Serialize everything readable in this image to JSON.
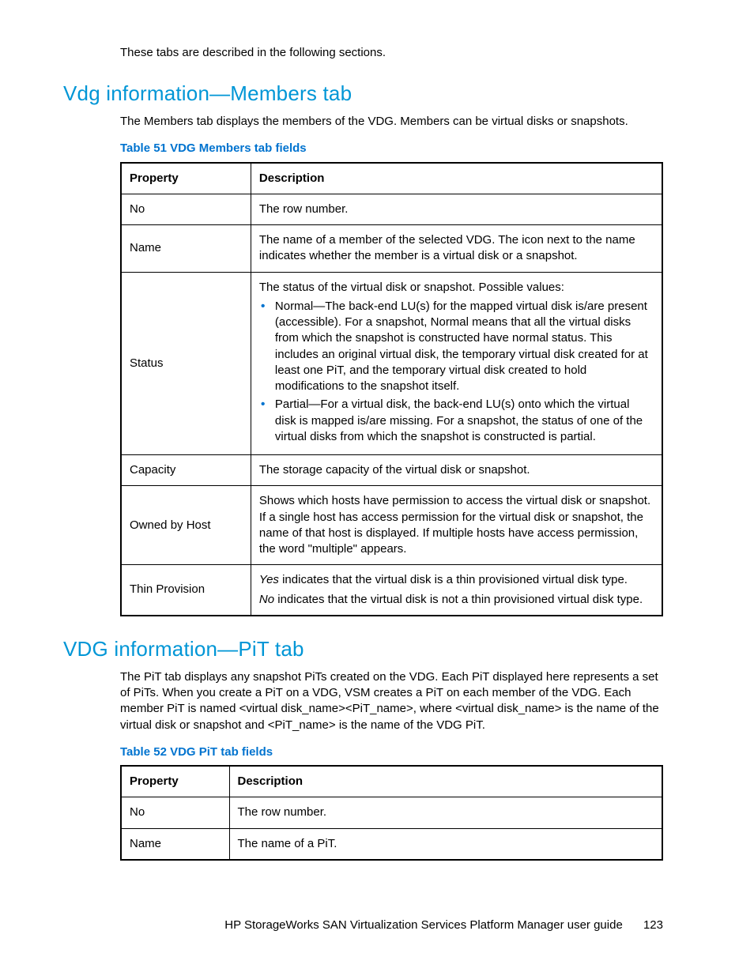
{
  "intro": "These tabs are described in the following sections.",
  "section1": {
    "heading": "Vdg information—Members tab",
    "body": "The Members tab displays the members of the VDG. Members can be virtual disks or snapshots.",
    "table_caption": "Table 51 VDG Members tab fields",
    "headers": {
      "prop": "Property",
      "desc": "Description"
    },
    "rows": {
      "r0": {
        "prop": "No",
        "desc": "The row number."
      },
      "r1": {
        "prop": "Name",
        "desc": "The name of a member of the selected VDG. The icon next to the name indicates whether the member is a virtual disk or a snapshot."
      },
      "r2": {
        "prop": "Status",
        "lead": "The status of the virtual disk or snapshot. Possible values:",
        "b0": "Normal—The back-end LU(s) for the mapped virtual disk is/are present (accessible). For a snapshot, Normal means that all the virtual disks from which the snapshot is constructed have normal status. This includes an original virtual disk, the temporary virtual disk created for at least one PiT, and the temporary virtual disk created to hold modifications to the snapshot itself.",
        "b1": "Partial—For a virtual disk, the back-end LU(s) onto which the virtual disk is mapped is/are missing. For a snapshot, the status of one of the virtual disks from which the snapshot is constructed is partial."
      },
      "r3": {
        "prop": "Capacity",
        "desc": "The storage capacity of the virtual disk or snapshot."
      },
      "r4": {
        "prop": "Owned by Host",
        "desc": "Shows which hosts have permission to access the virtual disk or snapshot. If a single host has access permission for the virtual disk or snapshot, the name of that host is displayed. If multiple hosts have access permission, the word \"multiple\" appears."
      },
      "r5": {
        "prop": "Thin Provision",
        "yes_word": "Yes",
        "yes_rest": " indicates that the virtual disk is a thin provisioned virtual disk type.",
        "no_word": "No",
        "no_rest": " indicates that the virtual disk is not a thin provisioned virtual disk type."
      }
    }
  },
  "section2": {
    "heading": "VDG information—PiT tab",
    "body": "The PiT tab displays any snapshot PiTs created on the VDG. Each PiT displayed here represents a set of PiTs. When you create a PiT on a VDG, VSM creates a PiT on each member of the VDG. Each member PiT is named <virtual disk_name><PiT_name>, where <virtual disk_name> is the name of the virtual disk or snapshot and <PiT_name> is the name of the VDG PiT.",
    "table_caption": "Table 52 VDG PiT tab fields",
    "headers": {
      "prop": "Property",
      "desc": "Description"
    },
    "rows": {
      "r0": {
        "prop": "No",
        "desc": "The row number."
      },
      "r1": {
        "prop": "Name",
        "desc": "The name of a PiT."
      }
    }
  },
  "footer": {
    "title": "HP StorageWorks SAN Virtualization Services Platform Manager user guide",
    "page": "123"
  }
}
